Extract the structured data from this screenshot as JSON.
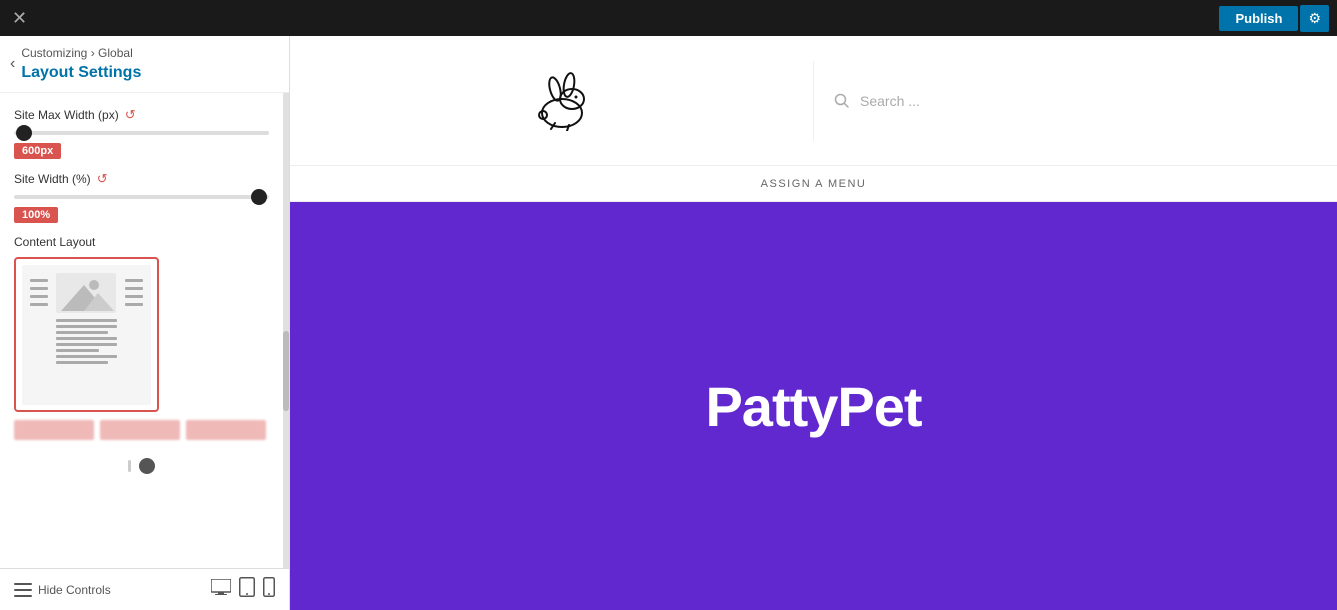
{
  "topbar": {
    "close_icon": "✕",
    "publish_label": "Publish",
    "gear_icon": "⚙"
  },
  "sidebar": {
    "back_icon": "‹",
    "breadcrumb": "Customizing",
    "breadcrumb_separator": "›",
    "breadcrumb_section": "Global",
    "section_title": "Layout Settings",
    "site_max_width_label": "Site Max Width (px)",
    "site_max_width_value": "600px",
    "site_width_label": "Site Width (%)",
    "site_width_value": "100%",
    "content_layout_label": "Content Layout",
    "refresh_icon": "↺",
    "hide_controls_label": "Hide Controls",
    "footer_icons": [
      "desktop",
      "tablet",
      "mobile"
    ]
  },
  "preview": {
    "search_placeholder": "Search ...",
    "assign_menu_text": "ASSIGN A MENU",
    "hero_title": "PattyPet",
    "hero_bg_color": "#6128D0"
  }
}
